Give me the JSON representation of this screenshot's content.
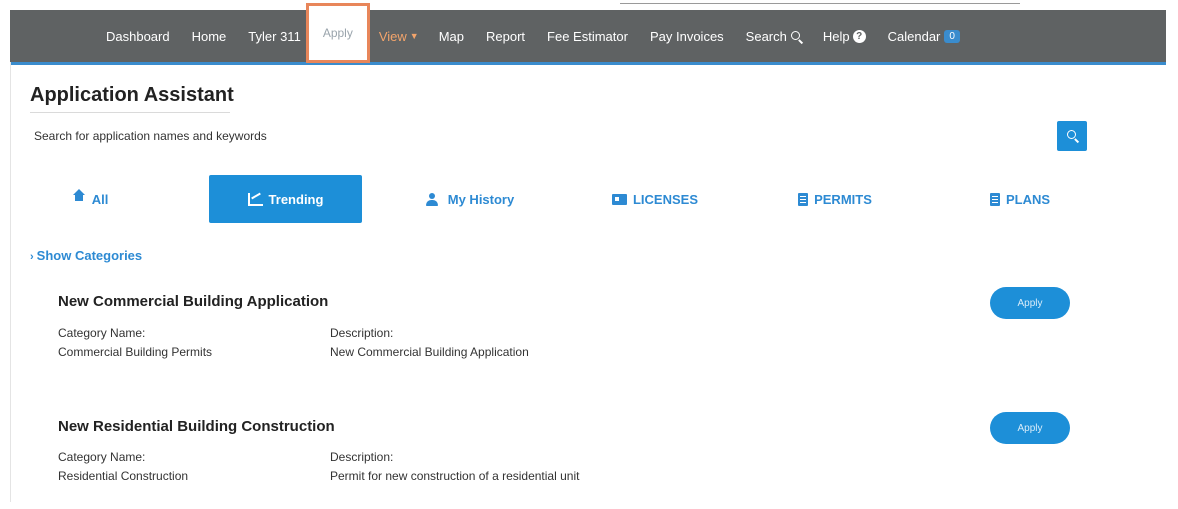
{
  "nav": {
    "items": [
      {
        "label": "Dashboard"
      },
      {
        "label": "Home"
      },
      {
        "label": "Tyler 311"
      },
      {
        "label": "Apply"
      },
      {
        "label": "View"
      },
      {
        "label": "Map"
      },
      {
        "label": "Report"
      },
      {
        "label": "Fee Estimator"
      },
      {
        "label": "Pay Invoices"
      },
      {
        "label": "Search"
      },
      {
        "label": "Help"
      },
      {
        "label": "Calendar"
      }
    ],
    "calendar_badge": "0",
    "active_item": "Apply",
    "highlight_color": "#e8865a"
  },
  "header": {
    "title": "Application Assistant"
  },
  "search": {
    "placeholder": "Search for application names and keywords",
    "button_icon": "search-icon"
  },
  "tabs": [
    {
      "label": "All",
      "icon": "home-icon"
    },
    {
      "label": "Trending",
      "icon": "trending-icon",
      "active": true
    },
    {
      "label": "My History",
      "icon": "user-icon"
    },
    {
      "label": "LICENSES",
      "icon": "id-card-icon"
    },
    {
      "label": "PERMITS",
      "icon": "document-icon"
    },
    {
      "label": "PLANS",
      "icon": "document-icon"
    }
  ],
  "show_categories": "Show Categories",
  "applications": [
    {
      "title": "New Commercial Building Application",
      "category_label": "Category Name:",
      "category_value": "Commercial Building Permits",
      "description_label": "Description:",
      "description_value": "New Commercial Building Application",
      "button": "Apply"
    },
    {
      "title": "New Residential Building Construction",
      "category_label": "Category Name:",
      "category_value": "Residential Construction",
      "description_label": "Description:",
      "description_value": "Permit for new construction of a residential unit",
      "button": "Apply"
    }
  ],
  "colors": {
    "nav_bg": "#5f6263",
    "accent": "#1d8fd8",
    "view_link": "#f3a46b"
  }
}
